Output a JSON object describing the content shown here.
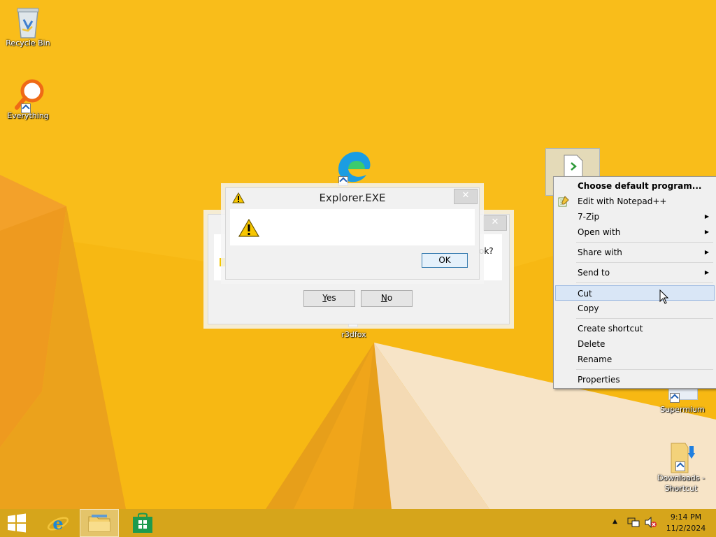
{
  "desktop": {
    "icons": [
      {
        "label": "Recycle Bin"
      },
      {
        "label": "Everything"
      },
      {
        "label": "r3dfox"
      },
      {
        "label": "Supermium"
      },
      {
        "label": "Downloads - Shortcut"
      }
    ]
  },
  "dialog_back": {
    "partial_text": "ok?",
    "yes_label": "Yes",
    "yes_accel": "Y",
    "yes_rest": "es",
    "no_label": "No",
    "no_accel": "N",
    "no_rest": "o"
  },
  "dialog_front": {
    "title": "Explorer.EXE",
    "ok_label": "OK"
  },
  "context_menu": {
    "items": [
      {
        "label": "Choose default program...",
        "bold": true
      },
      {
        "label": "Edit with Notepad++"
      },
      {
        "label": "7-Zip",
        "submenu": true
      },
      {
        "label": "Open with",
        "submenu": true
      },
      {
        "label": "Share with",
        "submenu": true
      },
      {
        "label": "Send to",
        "submenu": true
      },
      {
        "label": "Cut",
        "highlighted": true
      },
      {
        "label": "Copy"
      },
      {
        "label": "Create shortcut"
      },
      {
        "label": "Delete"
      },
      {
        "label": "Rename"
      },
      {
        "label": "Properties"
      }
    ]
  },
  "taskbar": {
    "clock_time": "9:14 PM",
    "clock_date": "11/2/2024"
  },
  "colors": {
    "wallpaper": "#f7b813",
    "taskbar": "#d6a51b",
    "menu_highlight": "#d9e6f6"
  }
}
